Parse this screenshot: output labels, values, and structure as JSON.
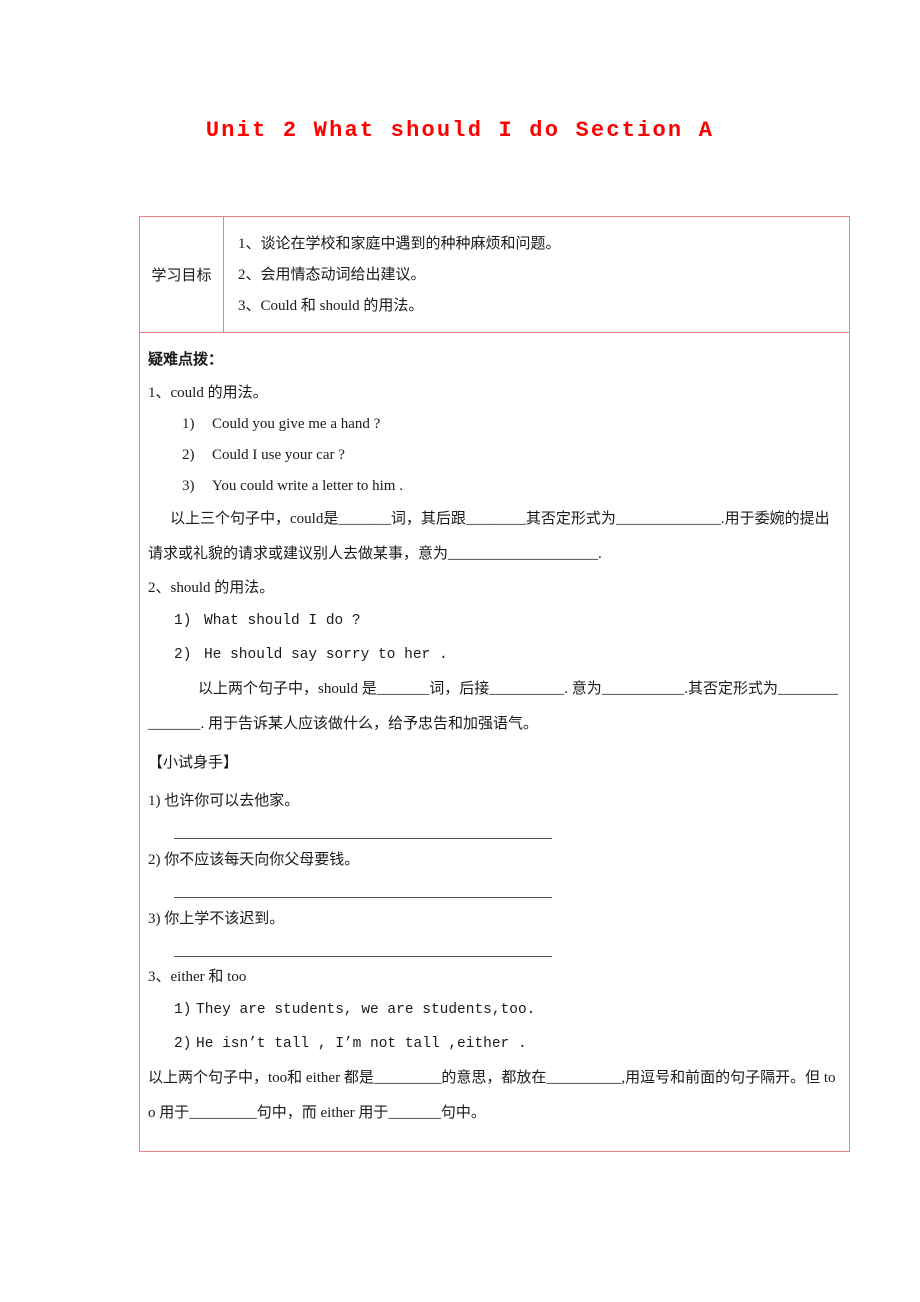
{
  "document": {
    "title": "Unit 2 What should I do Section A"
  },
  "goals": {
    "label": "学习目标",
    "items": [
      "1、谈论在学校和家庭中遇到的种种麻烦和问题。",
      "2、会用情态动词给出建议。",
      "3、Could 和 should 的用法。"
    ]
  },
  "difficult_points": {
    "heading": "疑难点拨：",
    "could": {
      "topic": "1、could 的用法。",
      "examples": [
        {
          "num": "1)",
          "text": "Could you give me a hand ?"
        },
        {
          "num": "2)",
          "text": "Could I use your car ?"
        },
        {
          "num": "3)",
          "text": "You could write a letter to him ."
        }
      ],
      "explanation": "以上三个句子中，could是_______词，其后跟________其否定形式为______________.用于委婉的提出请求或礼貌的请求或建议别人去做某事，意为____________________."
    },
    "should": {
      "topic": "2、should 的用法。",
      "examples": [
        {
          "num": "1)",
          "text": "What should I do ?"
        },
        {
          "num": "2)",
          "text": "He should say sorry to her ."
        }
      ],
      "explanation": "以上两个句子中，should 是_______词，后接__________. 意为___________.其否定形式为_______________. 用于告诉某人应该做什么，给予忠告和加强语气。"
    },
    "practice": {
      "heading": "【小试身手】",
      "items": [
        "1) 也许你可以去他家。",
        "2) 你不应该每天向你父母要钱。",
        "3) 你上学不该迟到。"
      ]
    },
    "either_too": {
      "topic": "3、either 和 too",
      "examples": [
        {
          "num": "1)",
          "text": "They are students, we are students,too."
        },
        {
          "num": "2)",
          "text": "He isn’t tall , I’m not tall ,either ."
        }
      ],
      "explanation": "以上两个句子中，too和 either 都是_________的意思，都放在__________,用逗号和前面的句子隔开。但 too 用于_________句中，而 either 用于_______句中。"
    }
  },
  "colors": {
    "title": "#ff0000",
    "table_border": "#f08080",
    "text": "#1a1a1a"
  }
}
